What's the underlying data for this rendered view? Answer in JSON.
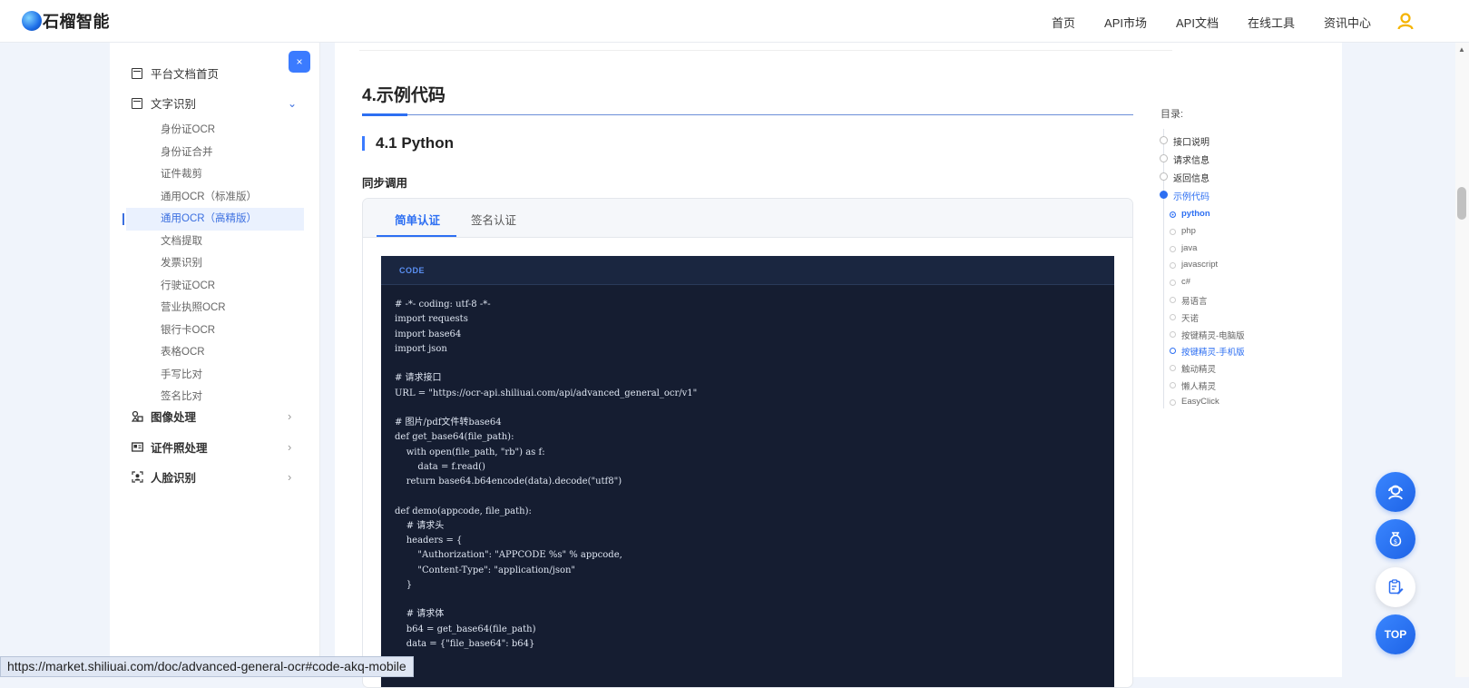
{
  "brand": {
    "name": "石榴智能"
  },
  "nav": {
    "items": [
      "首页",
      "API市场",
      "API文档",
      "在线工具",
      "资讯中心"
    ]
  },
  "sidebar": {
    "collapse_label": "×",
    "home_label": "平台文档首页",
    "ocr_group_label": "文字识别",
    "ocr_items": [
      "身份证OCR",
      "身份证合并",
      "证件裁剪",
      "通用OCR（标准版）",
      "通用OCR（高精版）",
      "文档提取",
      "发票识别",
      "行驶证OCR",
      "营业执照OCR",
      "银行卡OCR",
      "表格OCR",
      "手写比对",
      "签名比对"
    ],
    "active_index": 4,
    "groups": [
      "图像处理",
      "证件照处理",
      "人脸识别"
    ]
  },
  "content": {
    "section_title": "4.示例代码",
    "subsection_title": "4.1 Python",
    "call_type": "同步调用",
    "tabs": [
      "简单认证",
      "签名认证"
    ],
    "active_tab": 0,
    "code_label": "CODE",
    "code_lines": [
      "# -*- coding: utf-8 -*-",
      "import requests",
      "import base64",
      "import json",
      "",
      "# 请求接口",
      "URL = \"https://ocr-api.shiliuai.com/api/advanced_general_ocr/v1\"",
      "",
      "# 图片/pdf文件转base64",
      "def get_base64(file_path):",
      "    with open(file_path, \"rb\") as f:",
      "        data = f.read()",
      "    return base64.b64encode(data).decode(\"utf8\")",
      "",
      "def demo(appcode, file_path):",
      "    # 请求头",
      "    headers = {",
      "        \"Authorization\": \"APPCODE %s\" % appcode,",
      "        \"Content-Type\": \"application/json\"",
      "    }",
      "",
      "    # 请求体",
      "    b64 = get_base64(file_path)",
      "    data = {\"file_base64\": b64}"
    ]
  },
  "toc": {
    "title": "目录:",
    "items": [
      "接口说明",
      "请求信息",
      "返回信息",
      "示例代码"
    ],
    "active_index": 3,
    "sub_items": [
      "python",
      "php",
      "java",
      "javascript",
      "c#",
      "易语言",
      "天诺",
      "按键精灵-电脑版",
      "按键精灵-手机版",
      "触动精灵",
      "懒人精灵",
      "EasyClick"
    ],
    "sub_active_index": 0,
    "sub_hover_index": 8
  },
  "float_buttons": {
    "top_label": "TOP"
  },
  "status_bar": {
    "url": "https://market.shiliuai.com/doc/advanced-general-ocr#code-akq-mobile"
  },
  "colors": {
    "accent": "#2d6ff2",
    "code_bg": "#151d31",
    "page_bg": "#f0f4fb"
  }
}
